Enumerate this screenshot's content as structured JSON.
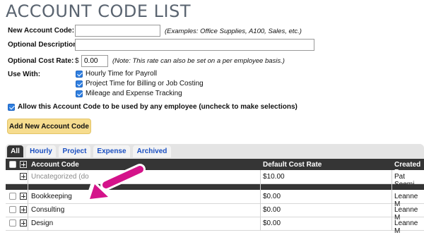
{
  "page": {
    "title": "ACCOUNT CODE LIST"
  },
  "form": {
    "new_code_label": "New Account Code:",
    "new_code_value": "",
    "new_code_note": "(Examples: Office Supplies, A100, Sales, etc.)",
    "description_label": "Optional Description:",
    "description_value": "",
    "cost_rate_label": "Optional Cost Rate:",
    "currency_symbol": "$",
    "cost_rate_value": "0.00",
    "cost_rate_note": "(Note: This rate can also be set on a per employee basis.)",
    "use_with_label": "Use With:",
    "use_with_options": [
      {
        "label": "Hourly Time for Payroll",
        "checked": true
      },
      {
        "label": "Project Time for Billing or Job Costing",
        "checked": true
      },
      {
        "label": "Mileage and Expense Tracking",
        "checked": true
      }
    ],
    "allow_all_label": "Allow this Account Code to be used by any employee (uncheck to make selections)",
    "allow_all_checked": true,
    "add_button_label": "Add New Account Code"
  },
  "tabs": [
    {
      "label": "All",
      "active": true
    },
    {
      "label": "Hourly",
      "active": false
    },
    {
      "label": "Project",
      "active": false
    },
    {
      "label": "Expense",
      "active": false
    },
    {
      "label": "Archived",
      "active": false
    }
  ],
  "table": {
    "columns": [
      "Account Code",
      "Default Cost Rate",
      "Created B"
    ],
    "rows": [
      {
        "code": "Uncategorized (do",
        "rate": "$10.00",
        "created": "Pat Seemi",
        "muted": true
      },
      {
        "code": "Bookkeeping",
        "rate": "$0.00",
        "created": "Leanne M"
      },
      {
        "code": "Consulting",
        "rate": "$0.00",
        "created": "Leanne M"
      },
      {
        "code": "Design",
        "rate": "$0.00",
        "created": "Leanne M"
      }
    ]
  },
  "colors": {
    "accent_arrow": "#d4138a",
    "button_bg": "#f6dc8e",
    "header_bg": "#353535",
    "link": "#1a4fc2"
  }
}
